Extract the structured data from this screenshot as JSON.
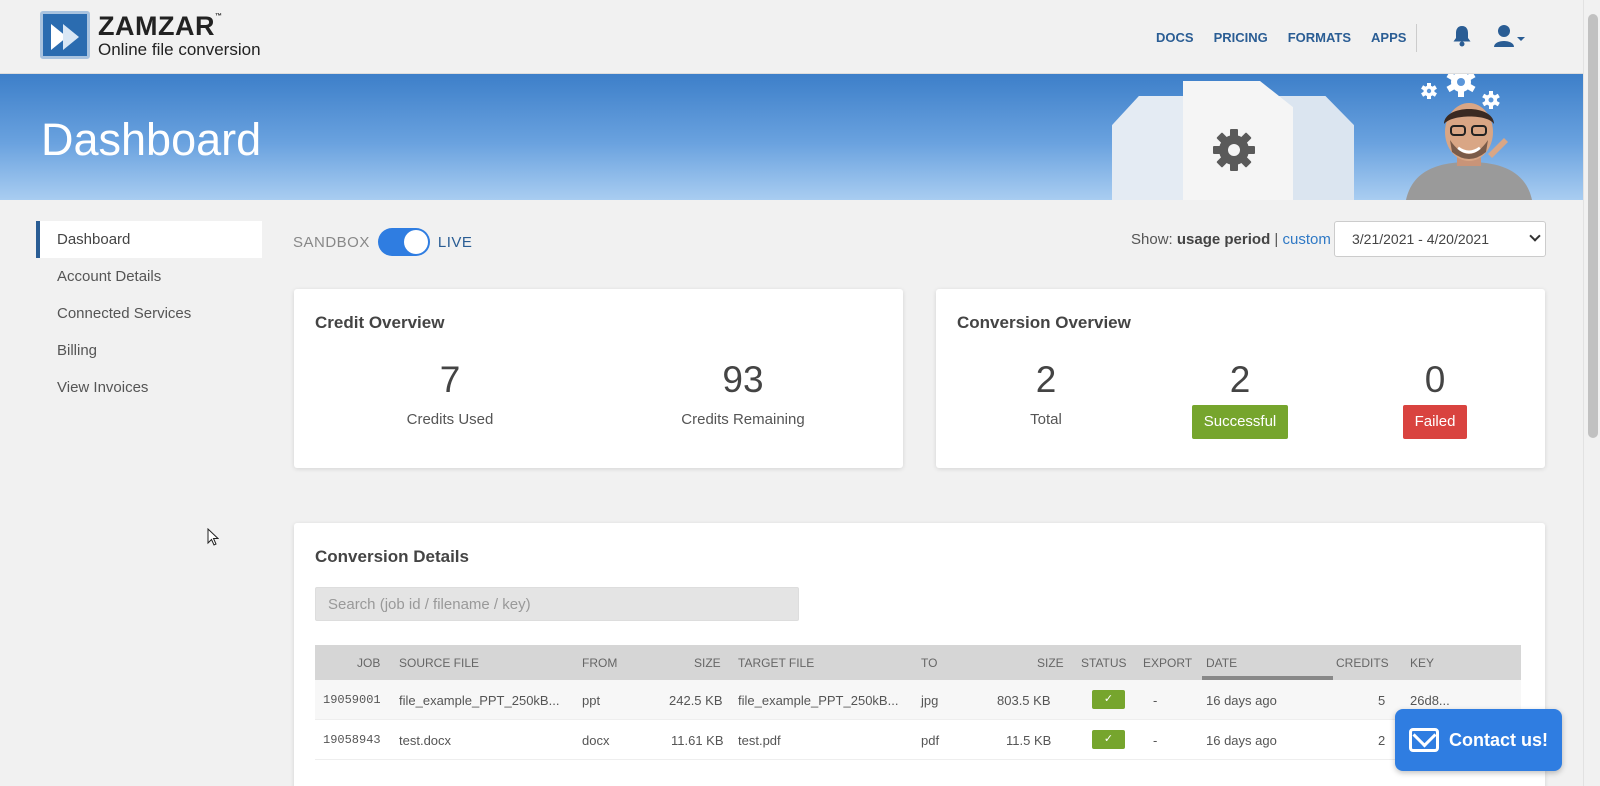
{
  "header": {
    "logo_title": "ZAMZAR",
    "logo_tm": "™",
    "logo_subtitle": "Online file conversion",
    "nav": [
      "DOCS",
      "PRICING",
      "FORMATS",
      "APPS"
    ],
    "icons": [
      "bell-icon",
      "user-icon"
    ]
  },
  "banner": {
    "title": "Dashboard"
  },
  "sidebar": {
    "items": [
      {
        "label": "Dashboard",
        "active": true
      },
      {
        "label": "Account Details"
      },
      {
        "label": "Connected Services"
      },
      {
        "label": "Billing"
      },
      {
        "label": "View Invoices"
      }
    ]
  },
  "mode": {
    "sandbox": "SANDBOX",
    "live": "LIVE",
    "enabled": true
  },
  "period": {
    "show_label": "Show:",
    "show_value": "usage period",
    "separator": "|",
    "custom": "custom",
    "selected": "3/21/2021 - 4/20/2021"
  },
  "credit_overview": {
    "title": "Credit Overview",
    "used_value": "7",
    "used_label": "Credits Used",
    "remaining_value": "93",
    "remaining_label": "Credits Remaining"
  },
  "conversion_overview": {
    "title": "Conversion Overview",
    "total_value": "2",
    "total_label": "Total",
    "success_value": "2",
    "success_label": "Successful",
    "failed_value": "0",
    "failed_label": "Failed"
  },
  "details": {
    "title": "Conversion Details",
    "search_placeholder": "Search (job id / filename / key)",
    "columns": [
      "JOB",
      "SOURCE FILE",
      "FROM",
      "SIZE",
      "TARGET FILE",
      "TO",
      "SIZE",
      "STATUS",
      "EXPORT",
      "DATE",
      "CREDITS",
      "KEY"
    ],
    "rows": [
      {
        "job": "19059001",
        "source": "file_example_PPT_250kB...",
        "from": "ppt",
        "size": "242.5 KB",
        "target": "file_example_PPT_250kB...",
        "to": "jpg",
        "tsize": "803.5 KB",
        "status": "✓",
        "export": "-",
        "date": "16 days ago",
        "credits": "5",
        "key": "26d8..."
      },
      {
        "job": "19058943",
        "source": "test.docx",
        "from": "docx",
        "size": "11.61 KB",
        "target": "test.pdf",
        "to": "pdf",
        "tsize": "11.5 KB",
        "status": "✓",
        "export": "-",
        "date": "16 days ago",
        "credits": "2",
        "key": ""
      }
    ]
  },
  "contact": {
    "label": "Contact us!"
  },
  "colors": {
    "accent": "#2f7de1",
    "success": "#76a52d",
    "danger": "#d9433f",
    "nav": "#2a5d94"
  }
}
